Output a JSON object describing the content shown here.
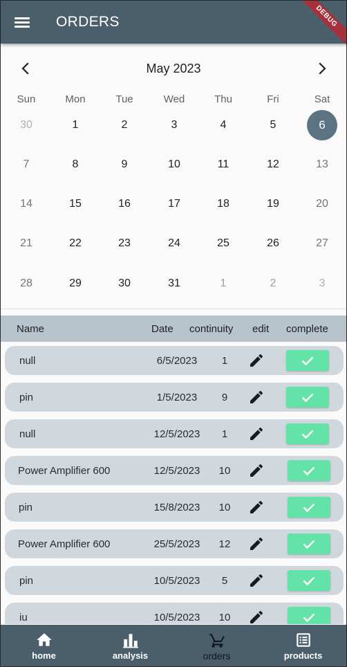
{
  "app_bar": {
    "title": "ORDERS",
    "debug_label": "DEBUG"
  },
  "calendar": {
    "month_label": "May 2023",
    "days_of_week": [
      "Sun",
      "Mon",
      "Tue",
      "Wed",
      "Thu",
      "Fri",
      "Sat"
    ],
    "weeks": [
      [
        {
          "d": "30",
          "m": true
        },
        {
          "d": "1"
        },
        {
          "d": "2"
        },
        {
          "d": "3"
        },
        {
          "d": "4"
        },
        {
          "d": "5"
        },
        {
          "d": "6",
          "sel": true
        }
      ],
      [
        {
          "d": "7"
        },
        {
          "d": "8"
        },
        {
          "d": "9"
        },
        {
          "d": "10"
        },
        {
          "d": "11"
        },
        {
          "d": "12"
        },
        {
          "d": "13"
        }
      ],
      [
        {
          "d": "14"
        },
        {
          "d": "15"
        },
        {
          "d": "16"
        },
        {
          "d": "17"
        },
        {
          "d": "18"
        },
        {
          "d": "19"
        },
        {
          "d": "20"
        }
      ],
      [
        {
          "d": "21"
        },
        {
          "d": "22"
        },
        {
          "d": "23"
        },
        {
          "d": "24"
        },
        {
          "d": "25"
        },
        {
          "d": "26"
        },
        {
          "d": "27"
        }
      ],
      [
        {
          "d": "28"
        },
        {
          "d": "29"
        },
        {
          "d": "30"
        },
        {
          "d": "31"
        },
        {
          "d": "1",
          "m": true
        },
        {
          "d": "2",
          "m": true
        },
        {
          "d": "3",
          "m": true
        }
      ]
    ],
    "selected_color": "#5c7383"
  },
  "orders_table": {
    "headers": {
      "name": "Name",
      "date": "Date",
      "continuity": "continuity",
      "edit": "edit",
      "complete": "complete"
    },
    "rows": [
      {
        "name": "null",
        "date": "6/5/2023",
        "continuity": "1"
      },
      {
        "name": "pin",
        "date": "1/5/2023",
        "continuity": "9"
      },
      {
        "name": "null",
        "date": "12/5/2023",
        "continuity": "1"
      },
      {
        "name": "Power Amplifier 600",
        "date": "12/5/2023",
        "continuity": "10"
      },
      {
        "name": "pin",
        "date": "15/8/2023",
        "continuity": "10"
      },
      {
        "name": "Power Amplifier 600",
        "date": "25/5/2023",
        "continuity": "12"
      },
      {
        "name": "pin",
        "date": "10/5/2023",
        "continuity": "5"
      },
      {
        "name": "iu",
        "date": "10/5/2023",
        "continuity": "10"
      }
    ],
    "edit_icon": "pencil-icon",
    "complete_icon": "check-icon",
    "complete_color": "#63e3a8"
  },
  "bottom_nav": {
    "items": [
      {
        "label": "home",
        "icon": "home-icon"
      },
      {
        "label": "analysis",
        "icon": "bar-chart-icon"
      },
      {
        "label": "orders",
        "icon": "cart-icon",
        "active": true
      },
      {
        "label": "products",
        "icon": "list-icon"
      }
    ]
  },
  "colors": {
    "app_bar": "#4b5e6b",
    "table_header": "#b7c4cc",
    "row_background": "#d1d8dd"
  }
}
